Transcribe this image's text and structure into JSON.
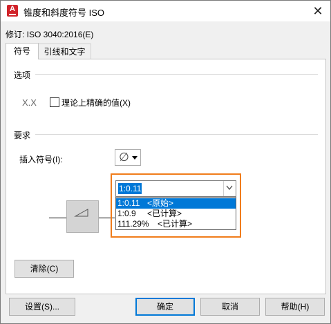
{
  "window": {
    "title": "锥度和斜度符号 ISO",
    "app_icon_letter": "A",
    "close_glyph": "✕"
  },
  "revision": "修订: ISO 3040:2016(E)",
  "tabs": [
    {
      "label": "符号"
    },
    {
      "label": "引线和文字"
    }
  ],
  "options": {
    "group_label": "选项",
    "sample_text": "X.X",
    "checkbox_label": "理论上精确的值(X)",
    "checkbox_checked": false
  },
  "requirements": {
    "group_label": "要求",
    "insert_label": "插入符号(I):",
    "insert_symbol": "∅",
    "combo_value": "1:0.11",
    "dropdown_options": [
      {
        "value": "1:0.11",
        "tag": "<原始>"
      },
      {
        "value": "1:0.9",
        "tag": "<已计算>"
      },
      {
        "value": "111.29%",
        "tag": "<已计算>"
      }
    ]
  },
  "buttons": {
    "clear": "清除(C)",
    "settings": "设置(S)...",
    "ok": "确定",
    "cancel": "取消",
    "help": "帮助(H)"
  },
  "colors": {
    "accent": "#0078d7",
    "highlight_frame": "#f07c1a",
    "icon_red": "#d1232a"
  }
}
